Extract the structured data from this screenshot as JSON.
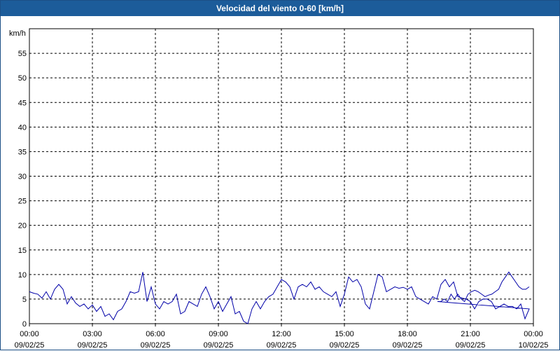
{
  "window": {
    "title": "Velocidad del viento 0-60 [km/h]"
  },
  "colors": {
    "title_bar": "#1c5c9a",
    "series": "#0000a8",
    "grid": "#000000"
  },
  "chart_data": {
    "type": "line",
    "title": "Velocidad del viento 0-60 [km/h]",
    "ylabel": "km/h",
    "xlabel": "",
    "ylim": [
      0,
      60
    ],
    "grid": true,
    "yticks": [
      0,
      5,
      10,
      15,
      20,
      25,
      30,
      35,
      40,
      45,
      50,
      55
    ],
    "xticks": [
      {
        "time": "00:00",
        "date": "09/02/25"
      },
      {
        "time": "03:00",
        "date": "09/02/25"
      },
      {
        "time": "06:00",
        "date": "09/02/25"
      },
      {
        "time": "09:00",
        "date": "09/02/25"
      },
      {
        "time": "12:00",
        "date": "09/02/25"
      },
      {
        "time": "15:00",
        "date": "09/02/25"
      },
      {
        "time": "18:00",
        "date": "09/02/25"
      },
      {
        "time": "21:00",
        "date": "09/02/25"
      },
      {
        "time": "00:00",
        "date": "10/02/25"
      }
    ],
    "series": [
      {
        "x_hours": [
          0,
          0.2,
          0.4,
          0.6,
          0.8,
          1.0,
          1.2,
          1.4,
          1.6,
          1.8,
          2.0,
          2.2,
          2.4,
          2.6,
          2.8,
          3.0,
          3.2,
          3.4,
          3.6,
          3.8,
          4.0,
          4.2,
          4.4,
          4.6,
          4.8,
          5.0,
          5.2,
          5.4,
          5.6,
          5.8,
          6.0,
          6.2,
          6.4,
          6.6,
          6.8,
          7.0,
          7.2,
          7.4,
          7.6,
          7.8,
          8.0,
          8.2,
          8.4,
          8.6,
          8.8,
          9.0,
          9.2,
          9.4,
          9.6,
          9.8,
          10.0,
          10.2,
          10.4,
          10.6,
          10.8,
          11.0,
          11.2,
          11.4,
          11.6,
          11.8,
          12.0,
          12.2,
          12.4,
          12.6,
          12.8,
          13.0,
          13.2,
          13.4,
          13.6,
          13.8,
          14.0,
          14.2,
          14.4,
          14.6,
          14.8,
          15.0,
          15.2,
          15.4,
          15.6,
          15.8,
          16.0,
          16.2,
          16.4,
          16.6,
          16.8,
          17.0,
          17.2,
          17.4,
          17.6,
          17.8,
          18.0,
          18.2,
          18.4,
          18.6,
          18.8,
          19.0,
          19.2,
          19.4,
          19.6,
          19.8,
          20.0,
          20.2,
          20.4,
          20.6,
          20.8,
          21.0,
          21.2,
          21.4,
          21.6,
          21.8,
          22.0,
          22.2,
          22.4,
          22.6,
          22.8,
          23.0,
          23.2,
          23.4,
          23.6,
          23.8
        ],
        "y": [
          6.5,
          6.2,
          6.0,
          5.2,
          6.5,
          5.0,
          7.0,
          8.0,
          7.0,
          4.0,
          5.5,
          4.2,
          3.5,
          4.0,
          3.0,
          3.8,
          2.5,
          3.5,
          1.5,
          2.0,
          0.8,
          2.5,
          3.0,
          4.5,
          6.5,
          6.2,
          6.5,
          10.5,
          4.5,
          7.5,
          4.0,
          3.0,
          4.5,
          4.0,
          4.5,
          6.0,
          2.0,
          2.5,
          4.5,
          4.0,
          3.5,
          6.0,
          7.5,
          5.5,
          3.0,
          4.5,
          2.5,
          4.0,
          5.5,
          2.0,
          2.5,
          0.5,
          0.0,
          3.0,
          4.5,
          3.0,
          4.5,
          5.5,
          6.0,
          7.5,
          9.0,
          8.5,
          7.5,
          5.0,
          7.5,
          8.0,
          7.5,
          8.5,
          7.0,
          7.5,
          6.5,
          6.0,
          5.5,
          6.5,
          3.5,
          6.0,
          9.5,
          8.5,
          9.0,
          7.5,
          4.0,
          3.0,
          6.5,
          10.0,
          9.5,
          6.5,
          7.0,
          7.5,
          7.2,
          7.4,
          7.0,
          7.5,
          5.5,
          5.0,
          4.5,
          4.0,
          5.5,
          5.0,
          8.0,
          9.0,
          7.5,
          8.5,
          5.5,
          5.2,
          5.0,
          4.5,
          3.0,
          4.5,
          5.0,
          5.0,
          4.5,
          3.0,
          3.5,
          4.0,
          3.5,
          3.5,
          3.0,
          4.0,
          1.0,
          3.0,
          4.5,
          4.5,
          5.0,
          4.5,
          6.0,
          5.0,
          6.0,
          5.0,
          4.5,
          6.0,
          6.5,
          6.8,
          6.5,
          6.0,
          5.5,
          5.8,
          6.0,
          6.5,
          7.0,
          8.5,
          9.5,
          10.5,
          9.5,
          8.5,
          7.5,
          7.0,
          7.0,
          7.5
        ]
      }
    ]
  }
}
